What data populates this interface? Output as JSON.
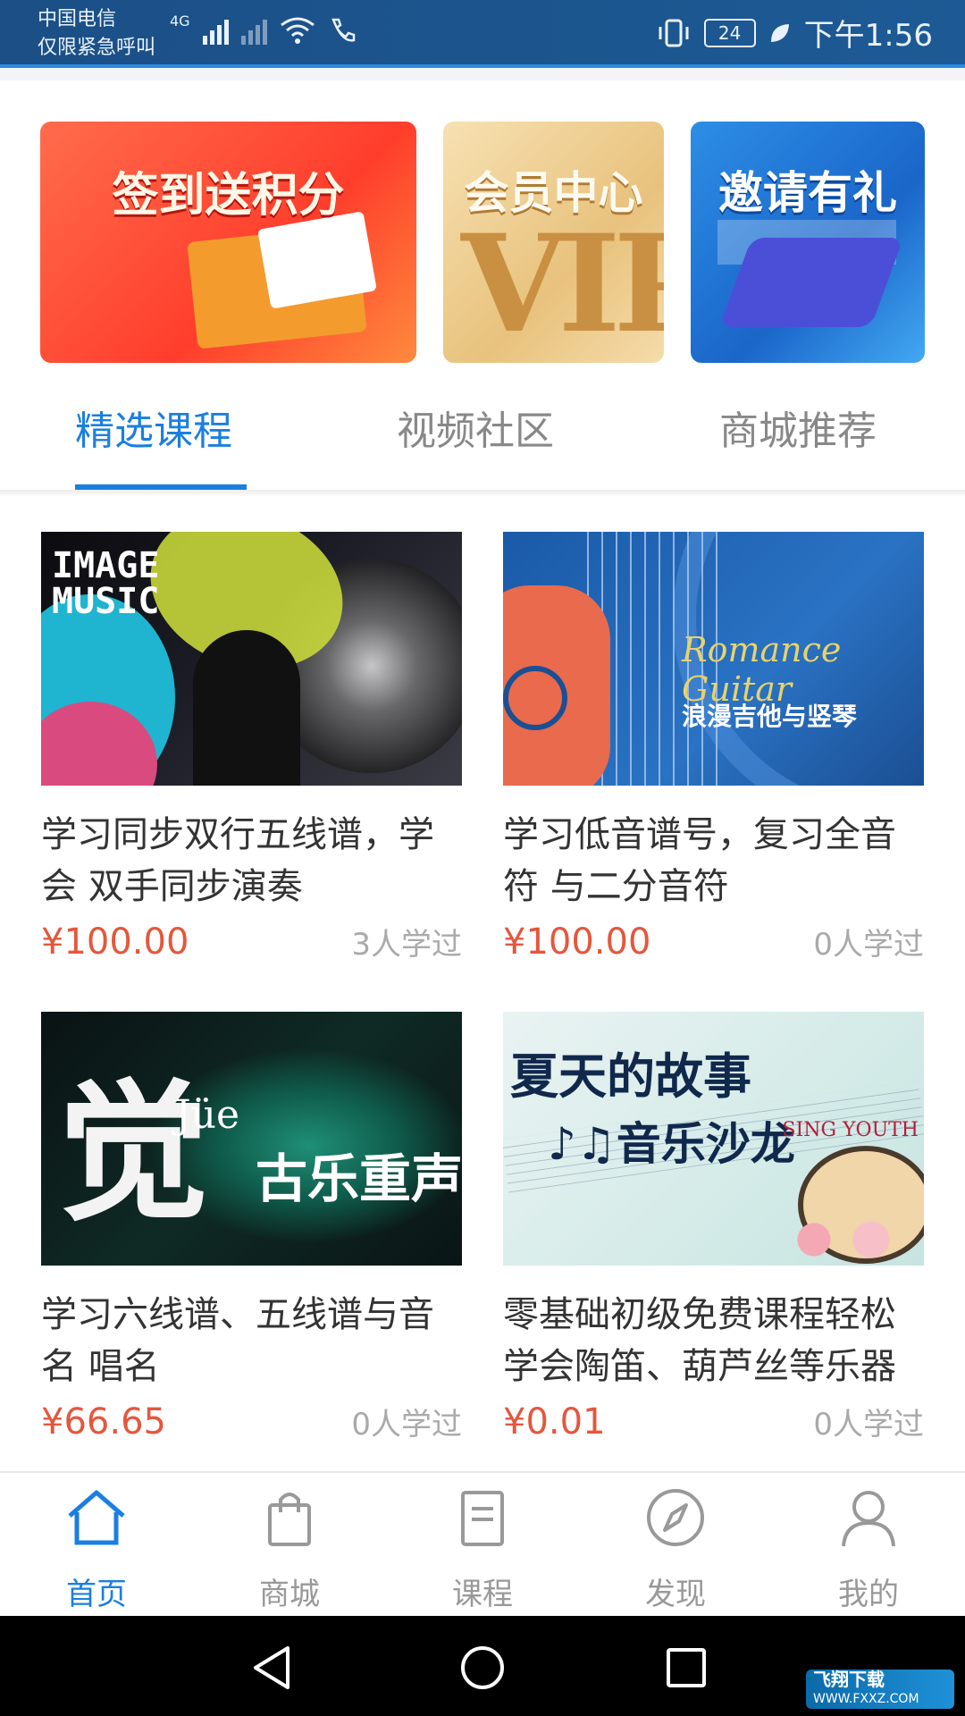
{
  "status_bar": {
    "carrier_line1": "中国电信",
    "carrier_line2": "仅限紧急呼叫",
    "network_type": "4G",
    "battery_level": "24",
    "time": "下午1:56"
  },
  "banners": [
    {
      "title": "签到送积分",
      "colors": [
        "#ff6c4c",
        "#ff3e2c"
      ]
    },
    {
      "title": "会员中心",
      "decoration_text": "VIP",
      "colors": [
        "#f7e1b2",
        "#e8c27d"
      ]
    },
    {
      "title": "邀请有礼",
      "colors": [
        "#2d8ee6",
        "#1a66c9"
      ]
    }
  ],
  "tabs": [
    {
      "label": "精选课程",
      "active": true
    },
    {
      "label": "视频社区",
      "active": false
    },
    {
      "label": "商城推荐",
      "active": false
    }
  ],
  "courses": [
    {
      "thumb_text": "IMAGE\nMUSIC",
      "title": "学习同步双行五线谱，学会 双手同步演奏",
      "price": "¥100.00",
      "learned": "3人学过"
    },
    {
      "thumb_text_en": "Romance Guitar",
      "thumb_text_cn": "浪漫吉他与竖琴",
      "title": "学习低音谱号，复习全音符 与二分音符",
      "price": "¥100.00",
      "learned": "0人学过"
    },
    {
      "thumb_glyph": "觉",
      "thumb_text_en": "Jüe",
      "thumb_text_cn": "古乐重声",
      "title": "学习六线谱、五线谱与音名 唱名",
      "price": "¥66.65",
      "learned": "0人学过"
    },
    {
      "thumb_title1": "夏天的故事",
      "thumb_title2": "♪♫音乐沙龙",
      "thumb_side": "SING YOUTH",
      "title": "零基础初级免费课程轻松学会陶笛、葫芦丝等乐器",
      "price": "¥0.01",
      "learned": "0人学过"
    }
  ],
  "bottom_nav": [
    {
      "label": "首页",
      "icon": "home-icon",
      "active": true
    },
    {
      "label": "商城",
      "icon": "shopping-bag-icon",
      "active": false
    },
    {
      "label": "课程",
      "icon": "document-icon",
      "active": false
    },
    {
      "label": "发现",
      "icon": "compass-icon",
      "active": false
    },
    {
      "label": "我的",
      "icon": "person-icon",
      "active": false
    }
  ],
  "system_nav": [
    "back-icon",
    "home-circle-icon",
    "recents-icon"
  ],
  "watermark": {
    "line1": "飞翔下载",
    "line2": "WWW.FXXZ.COM"
  },
  "colors": {
    "accent": "#1a7fe0",
    "price": "#e4573c",
    "status_bar": "#1b4f86"
  }
}
